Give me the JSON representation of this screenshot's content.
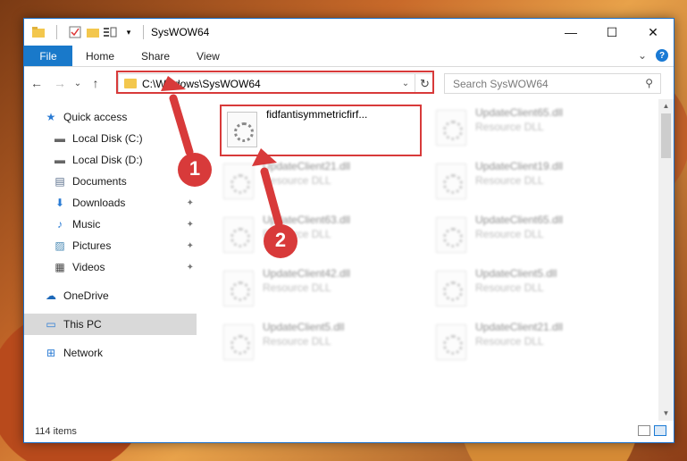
{
  "window": {
    "title": "SysWOW64",
    "controls": [
      "—",
      "☐",
      "✕"
    ]
  },
  "ribbon": {
    "tabs": [
      "File",
      "Home",
      "Share",
      "View"
    ],
    "expand": "⌄",
    "help": "?"
  },
  "nav": {
    "back": "←",
    "forward": "→",
    "recent": "⌄",
    "up": "↑",
    "address": "C:\\Windows\\SysWOW64",
    "address_chevron": "⌄",
    "refresh": "↻",
    "search_placeholder": "Search SysWOW64",
    "search_icon": "⚲"
  },
  "sidebar": {
    "quick_access": "Quick access",
    "items": [
      {
        "label": "Local Disk (C:)",
        "icon": "drive-icon",
        "glyph": "▬",
        "pinned": false
      },
      {
        "label": "Local Disk (D:)",
        "icon": "drive-icon",
        "glyph": "▬",
        "pinned": false
      },
      {
        "label": "Documents",
        "icon": "documents-icon",
        "glyph": "▤",
        "pinned": true
      },
      {
        "label": "Downloads",
        "icon": "downloads-icon",
        "glyph": "⬇",
        "pinned": true
      },
      {
        "label": "Music",
        "icon": "music-icon",
        "glyph": "♪",
        "pinned": true
      },
      {
        "label": "Pictures",
        "icon": "pictures-icon",
        "glyph": "▨",
        "pinned": true
      },
      {
        "label": "Videos",
        "icon": "videos-icon",
        "glyph": "▦",
        "pinned": true
      }
    ],
    "onedrive": "OneDrive",
    "this_pc": "This PC",
    "network": "Network",
    "pin_glyph": "📌"
  },
  "files": [
    {
      "name": "fidfantisymmetricfirf...",
      "type": "",
      "selected": true,
      "blurred": false
    },
    {
      "name": "UpdateClient65.dll",
      "type": "Resource DLL",
      "selected": false,
      "blurred": true
    },
    {
      "name": "UpdateClient21.dll",
      "type": "Resource DLL",
      "selected": false,
      "blurred": true
    },
    {
      "name": "UpdateClient19.dll",
      "type": "Resource DLL",
      "selected": false,
      "blurred": true
    },
    {
      "name": "UpdateClient63.dll",
      "type": "Resource DLL",
      "selected": false,
      "blurred": true
    },
    {
      "name": "UpdateClient65.dll",
      "type": "Resource DLL",
      "selected": false,
      "blurred": true
    },
    {
      "name": "UpdateClient42.dll",
      "type": "Resource DLL",
      "selected": false,
      "blurred": true
    },
    {
      "name": "UpdateClient5.dll",
      "type": "Resource DLL",
      "selected": false,
      "blurred": true
    },
    {
      "name": "UpdateClient5.dll",
      "type": "Resource DLL",
      "selected": false,
      "blurred": true
    },
    {
      "name": "UpdateClient21.dll",
      "type": "Resource DLL",
      "selected": false,
      "blurred": true
    }
  ],
  "status": {
    "count": "114 items"
  },
  "annotations": {
    "step1": "1",
    "step2": "2",
    "color": "#d83a3a"
  }
}
